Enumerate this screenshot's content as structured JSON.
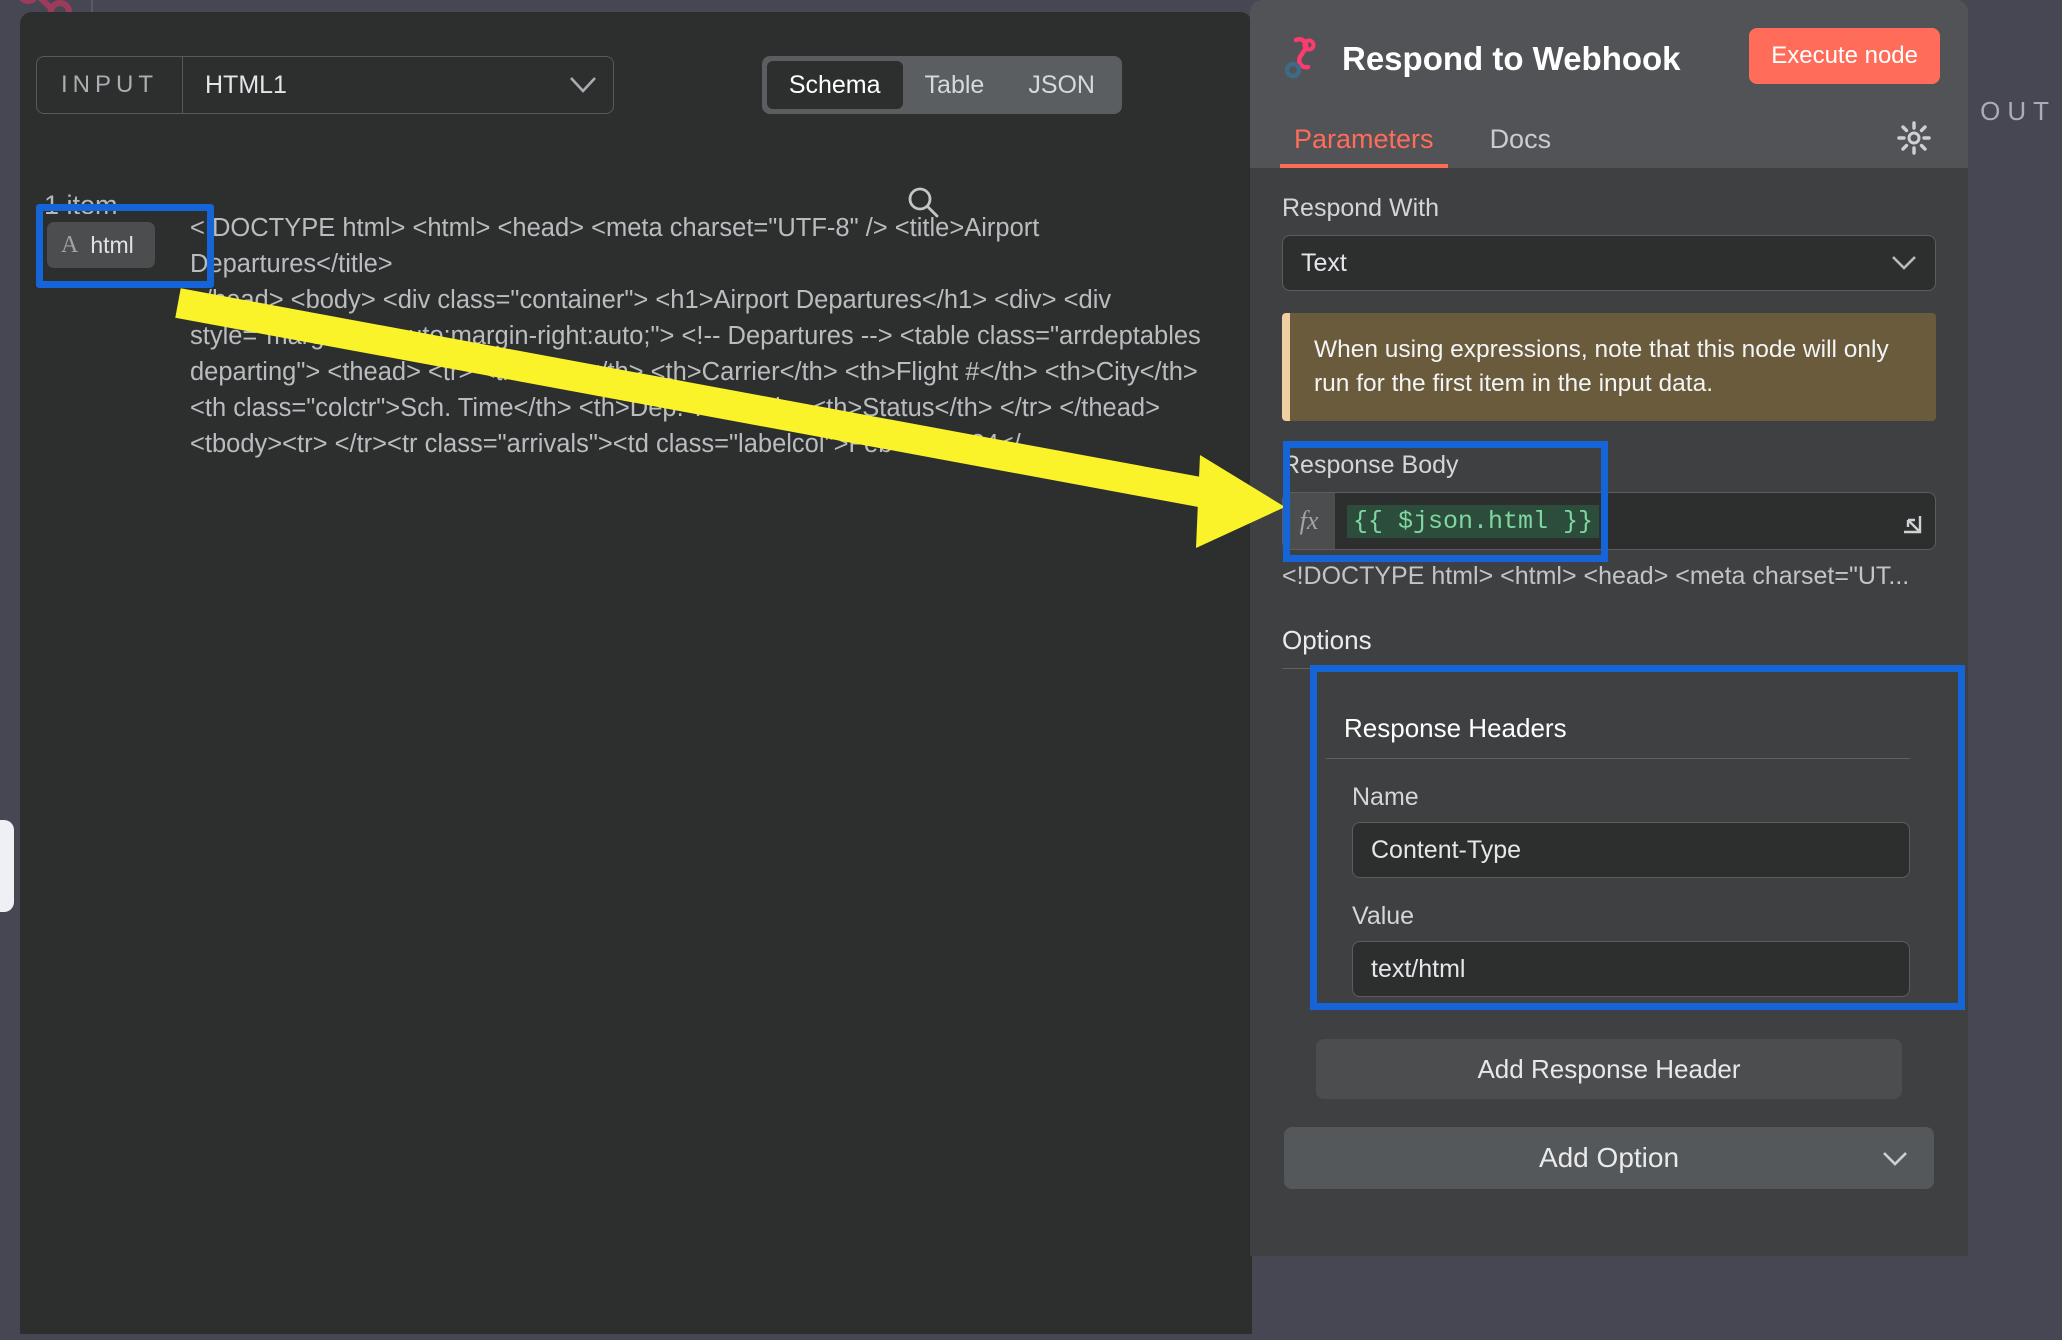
{
  "canvas": {
    "logo_icon": "n8n-logo-icon",
    "output_label": "OUT"
  },
  "input_panel": {
    "select": {
      "label": "INPUT",
      "value": "HTML1",
      "chevron_icon": "chevron-down-icon"
    },
    "view_tabs": [
      {
        "label": "Schema",
        "active": true
      },
      {
        "label": "Table",
        "active": false
      },
      {
        "label": "JSON",
        "active": false
      }
    ],
    "item_count": "1 item",
    "search_icon": "search-icon",
    "schema": {
      "type_glyph": "A",
      "key": "html",
      "separator": ":",
      "value_lines": [
        "<!DOCTYPE html> <html> <head> <meta charset=\"UTF-8\" /> <title>Airport Departures</title>",
        "</head> <body> <div class=\"container\"> <h1>Airport Departures</h1> <div> <div",
        "style=\"margin-left:auto;margin-right:auto;\"> <!-- Departures --> <table class=\"arrdeptables",
        "departing\"> <thead> <tr> <th>Date</th> <th>Carrier</th> <th>Flight #</th> <th>City</th>",
        "<th class=\"colctr\">Sch. Time</th> <th>Dep. Time</th> <th>Status</th> </tr> </thead>",
        "<tbody><tr> </tr><tr class=\"arrivals\"><td class=\"labelcol\">Feb 22, 2024</..."
      ]
    }
  },
  "node_panel": {
    "icon": "respond-to-webhook-icon",
    "title": "Respond to Webhook",
    "execute_label": "Execute node",
    "tabs": [
      {
        "label": "Parameters",
        "active": true
      },
      {
        "label": "Docs",
        "active": false
      }
    ],
    "gear_icon": "gear-icon",
    "respond_with": {
      "label": "Respond With",
      "value": "Text",
      "chevron_icon": "chevron-down-icon"
    },
    "notice": "When using expressions, note that this node will only run for the first item in the input data.",
    "response_body": {
      "label": "Response Body",
      "fx_badge": "fx",
      "expression": "{{ $json.html }}",
      "expand_icon": "expand-icon",
      "preview": "<!DOCTYPE html> <html> <head>  <meta charset=\"UT..."
    },
    "options": {
      "title": "Options",
      "response_headers": {
        "title": "Response Headers",
        "name_label": "Name",
        "name_value": "Content-Type",
        "value_label": "Value",
        "value_value": "text/html"
      },
      "add_response_header_label": "Add Response Header",
      "add_option_label": "Add Option",
      "add_option_chevron_icon": "chevron-down-icon"
    }
  },
  "annotations": {
    "highlight_color": "#1565d8",
    "arrow_color": "#fbf32a"
  }
}
